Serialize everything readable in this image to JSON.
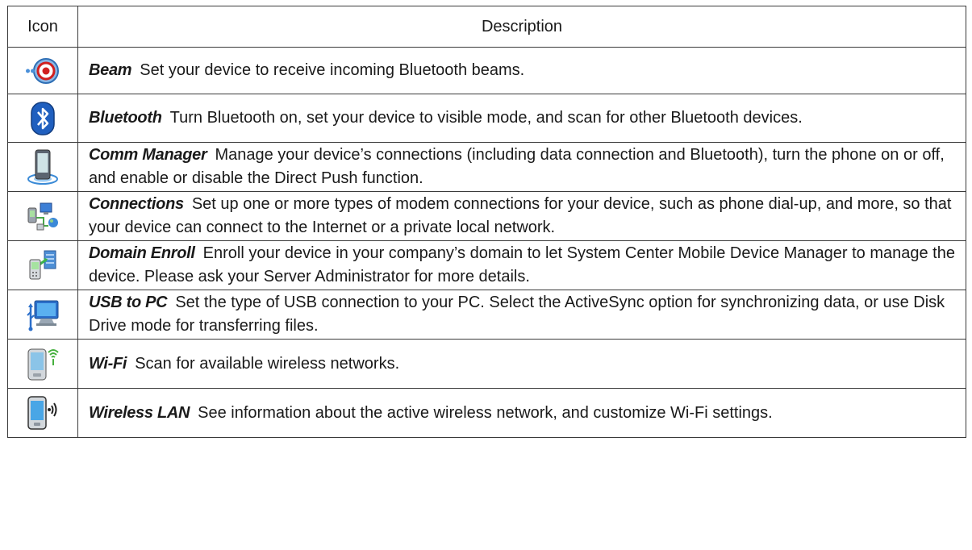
{
  "header": {
    "icon": "Icon",
    "description": "Description"
  },
  "rows": [
    {
      "icon": "beam-icon",
      "term": "Beam",
      "text": "Set your device to receive incoming Bluetooth beams."
    },
    {
      "icon": "bluetooth-icon",
      "term": "Bluetooth",
      "text": "Turn Bluetooth on, set your device to visible mode, and scan for other Bluetooth devices."
    },
    {
      "icon": "comm-manager-icon",
      "term": "Comm Manager",
      "text": "Manage your device’s connections (including data connection and Bluetooth), turn the phone on or off, and enable or disable the Direct Push function."
    },
    {
      "icon": "connections-icon",
      "term": "Connections",
      "text": "Set up one or more types of modem connections for your device, such as phone dial-up, and more, so that your device can connect to the Internet or a private local network."
    },
    {
      "icon": "domain-enroll-icon",
      "term": "Domain Enroll",
      "text": "Enroll your device in your company’s domain to let System Center Mobile Device Manager to manage the device. Please ask your Server Administrator for more details."
    },
    {
      "icon": "usb-to-pc-icon",
      "term": "USB to PC",
      "text": "Set the type of USB connection to your PC. Select the ActiveSync option for synchronizing data, or use Disk Drive mode for transferring files."
    },
    {
      "icon": "wifi-icon",
      "term": "Wi-Fi",
      "text": "Scan for available wireless networks."
    },
    {
      "icon": "wireless-lan-icon",
      "term": "Wireless LAN",
      "text": "See information about the active wireless network, and customize Wi-Fi settings."
    }
  ]
}
